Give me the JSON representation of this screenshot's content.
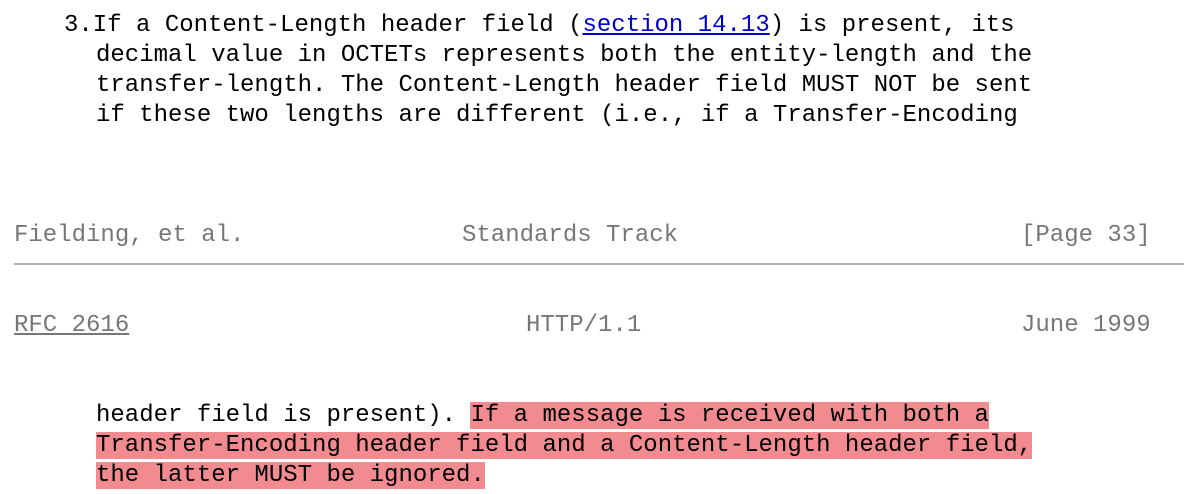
{
  "top_paragraph": {
    "line1_prefix": "3.If a Content-Length header field (",
    "line1_link": "section 14.13",
    "line1_suffix": ") is present, its",
    "line2": "decimal value in OCTETs represents both the entity-length and the",
    "line3": "transfer-length. The Content-Length header field MUST NOT be sent",
    "line4": "if these two lengths are different (i.e., if a Transfer-Encoding"
  },
  "page_footer": {
    "author": "Fielding, et al.",
    "category": "Standards Track",
    "page": "[Page 33]"
  },
  "page_header": {
    "rfc_link": "RFC 2616",
    "protocol": "HTTP/1.1",
    "date": "June 1999"
  },
  "bottom_paragraph": {
    "line1_plain": "header field is present). ",
    "line1_highlight": "If a message is received with both a",
    "line2_highlight": "Transfer-Encoding header field and a Content-Length header field,",
    "line3_highlight": "the latter MUST be ignored."
  },
  "colors": {
    "link": "#0000cc",
    "header_footer_text": "#777777",
    "highlight": "#f28b90",
    "rule": "#a9a9a9"
  }
}
